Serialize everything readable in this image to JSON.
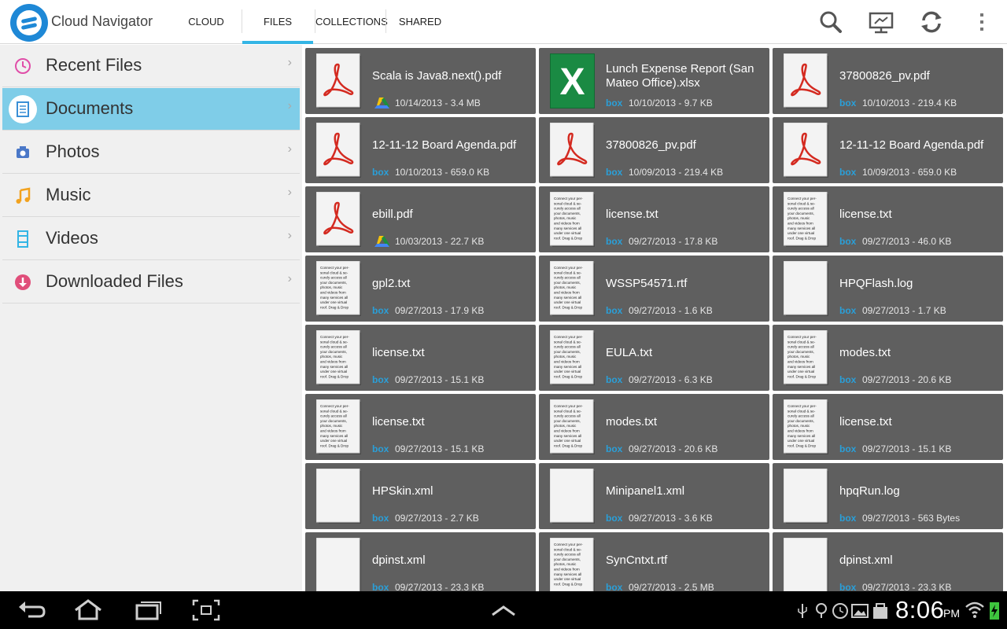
{
  "app": {
    "title": "Cloud Navigator"
  },
  "tabs": [
    {
      "label": "CLOUD"
    },
    {
      "label": "FILES",
      "active": true
    },
    {
      "label": "COLLECTIONS"
    },
    {
      "label": "SHARED"
    }
  ],
  "header_icons": [
    "search-icon",
    "cast-screen-icon",
    "refresh-icon",
    "overflow-menu-icon"
  ],
  "sidebar": {
    "items": [
      {
        "label": "Recent Files",
        "icon": "clock-icon",
        "color": "#e04ea8"
      },
      {
        "label": "Documents",
        "icon": "document-icon",
        "color": "#3a8fd6",
        "active": true
      },
      {
        "label": "Photos",
        "icon": "camera-icon",
        "color": "#4a78c8"
      },
      {
        "label": "Music",
        "icon": "music-note-icon",
        "color": "#f2a21e"
      },
      {
        "label": "Videos",
        "icon": "film-icon",
        "color": "#33b5e5"
      },
      {
        "label": "Downloaded Files",
        "icon": "download-icon",
        "color": "#e04e7a"
      }
    ]
  },
  "files": [
    {
      "name": "Scala is Java8.next().pdf",
      "meta": "10/14/2013 - 3.4 MB",
      "type": "pdf",
      "source": "gdrive"
    },
    {
      "name": "Lunch Expense Report (San Mateo Office).xlsx",
      "meta": "10/10/2013 - 9.7 KB",
      "type": "xlsx",
      "source": "box"
    },
    {
      "name": "37800826_pv.pdf",
      "meta": "10/10/2013 - 219.4 KB",
      "type": "pdf",
      "source": "box"
    },
    {
      "name": "12-11-12 Board Agenda.pdf",
      "meta": "10/10/2013 - 659.0 KB",
      "type": "pdf",
      "source": "box"
    },
    {
      "name": "37800826_pv.pdf",
      "meta": "10/09/2013 - 219.4 KB",
      "type": "pdf",
      "source": "box"
    },
    {
      "name": "12-11-12 Board Agenda.pdf",
      "meta": "10/09/2013 - 659.0 KB",
      "type": "pdf",
      "source": "box"
    },
    {
      "name": "ebill.pdf",
      "meta": "10/03/2013 - 22.7 KB",
      "type": "pdf",
      "source": "gdrive"
    },
    {
      "name": "license.txt",
      "meta": "09/27/2013 - 17.8 KB",
      "type": "txt",
      "source": "box"
    },
    {
      "name": "license.txt",
      "meta": "09/27/2013 - 46.0 KB",
      "type": "txt",
      "source": "box"
    },
    {
      "name": "gpl2.txt",
      "meta": "09/27/2013 - 17.9 KB",
      "type": "txt",
      "source": "box"
    },
    {
      "name": "WSSP54571.rtf",
      "meta": "09/27/2013 - 1.6 KB",
      "type": "txt",
      "source": "box"
    },
    {
      "name": "HPQFlash.log",
      "meta": "09/27/2013 - 1.7 KB",
      "type": "blank",
      "source": "box"
    },
    {
      "name": "license.txt",
      "meta": "09/27/2013 - 15.1 KB",
      "type": "txt",
      "source": "box"
    },
    {
      "name": "EULA.txt",
      "meta": "09/27/2013 - 6.3 KB",
      "type": "txt",
      "source": "box"
    },
    {
      "name": "modes.txt",
      "meta": "09/27/2013 - 20.6 KB",
      "type": "txt",
      "source": "box"
    },
    {
      "name": "license.txt",
      "meta": "09/27/2013 - 15.1 KB",
      "type": "txt",
      "source": "box"
    },
    {
      "name": "modes.txt",
      "meta": "09/27/2013 - 20.6 KB",
      "type": "txt",
      "source": "box"
    },
    {
      "name": "license.txt",
      "meta": "09/27/2013 - 15.1 KB",
      "type": "txt",
      "source": "box"
    },
    {
      "name": "HPSkin.xml",
      "meta": "09/27/2013 - 2.7 KB",
      "type": "blank",
      "source": "box"
    },
    {
      "name": "Minipanel1.xml",
      "meta": "09/27/2013 - 3.6 KB",
      "type": "blank",
      "source": "box"
    },
    {
      "name": "hpqRun.log",
      "meta": "09/27/2013 - 563 Bytes",
      "type": "blank",
      "source": "box"
    },
    {
      "name": "dpinst.xml",
      "meta": "09/27/2013 - 23.3 KB",
      "type": "blank",
      "source": "box"
    },
    {
      "name": "SynCntxt.rtf",
      "meta": "09/27/2013 - 2.5 MB",
      "type": "txt",
      "source": "box"
    },
    {
      "name": "dpinst.xml",
      "meta": "09/27/2013 - 23.3 KB",
      "type": "blank",
      "source": "box"
    }
  ],
  "txt_thumbnail_lines": [
    "Connect your per-",
    "sonal cloud & se-",
    "curely access all",
    "your documents,",
    "photos, music",
    "and videos from",
    "many services all",
    "under one virtual",
    "roof. Drag & Drop"
  ],
  "source_labels": {
    "box": "box"
  },
  "xlsx_letter": "X",
  "navbar": {
    "icons": [
      "back-icon",
      "home-icon",
      "recent-apps-icon",
      "screenshot-icon",
      "up-chevron-icon"
    ],
    "status_icons": [
      "usb-icon",
      "lightbulb-icon",
      "clock-status-icon",
      "image-icon",
      "shopping-bag-icon",
      "wifi-icon",
      "battery-icon"
    ],
    "time": "8:06",
    "ampm": "PM"
  }
}
